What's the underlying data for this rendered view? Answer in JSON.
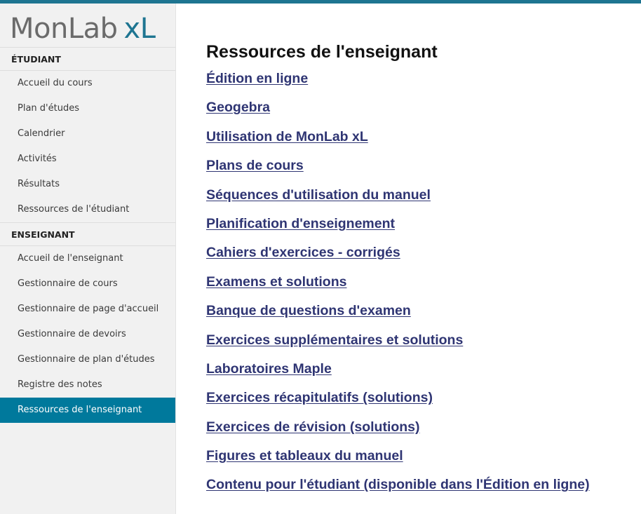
{
  "logo": {
    "part1": "MonLab",
    "part2": "xL"
  },
  "sidebar": {
    "student_header": "ÉTUDIANT",
    "student_items": [
      "Accueil du cours",
      "Plan d'études",
      "Calendrier",
      "Activités",
      "Résultats",
      "Ressources de l'étudiant"
    ],
    "teacher_header": "ENSEIGNANT",
    "teacher_items": [
      "Accueil de l'enseignant",
      "Gestionnaire de cours",
      "Gestionnaire de page d'accueil",
      "Gestionnaire de devoirs",
      "Gestionnaire de plan d'études",
      "Registre des notes",
      "Ressources de l'enseignant"
    ],
    "active_item": "Ressources de l'enseignant"
  },
  "main": {
    "title": "Ressources de l'enseignant",
    "links": [
      "Édition en ligne",
      "Geogebra",
      "Utilisation de MonLab xL",
      "Plans de cours",
      "Séquences d'utilisation du manuel",
      "Planification d'enseignement",
      "Cahiers d'exercices - corrigés",
      "Examens et solutions",
      "Banque de questions d'examen",
      "Exercices supplémentaires et solutions",
      "Laboratoires Maple",
      "Exercices récapitulatifs (solutions)",
      "Exercices de révision (solutions)",
      "Figures et tableaux du manuel",
      "Contenu pour l'étudiant (disponible dans l'Édition en ligne)"
    ]
  },
  "colors": {
    "accent": "#00799c",
    "link": "#2f3573",
    "sidebar_bg": "#f1f1f1"
  }
}
